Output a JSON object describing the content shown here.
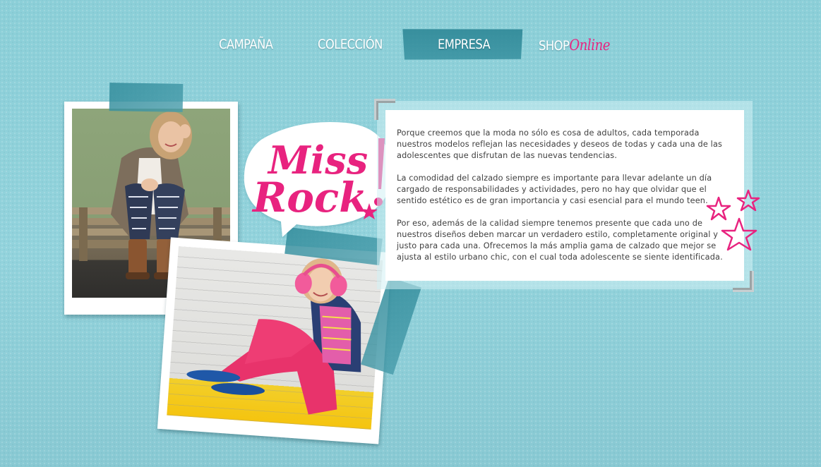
{
  "nav": {
    "items": [
      {
        "label": "CAMPAÑA"
      },
      {
        "label": "COLECCIÓN"
      },
      {
        "label": "EMPRESA",
        "active": true
      },
      {
        "label_main": "SHOP",
        "label_accent": "Online"
      }
    ]
  },
  "logo": {
    "line1": "Miss",
    "line2": "Rock"
  },
  "content": {
    "paragraphs": [
      "Porque creemos que la moda no sólo es cosa de adultos, cada temporada nuestros modelos reflejan las necesidades y deseos de todas y cada una de las adolescentes que disfrutan de las nuevas tendencias.",
      "La comodidad del calzado siempre es importante para llevar adelante un día cargado de responsabilidades y actividades, pero no hay que olvidar que el sentido estético es de gran importancia y casi esencial para el mundo teen.",
      "Por eso, además de la calidad siempre tenemos presente que cada uno de nuestros diseños deben marcar un verdadero estilo, completamente original y justo para cada una. Ofrecemos la más amplia gama de calzado que mejor se ajusta al estilo urbano chic, con el cual toda adolescente se siente identificada."
    ]
  },
  "colors": {
    "background": "#8fcfd8",
    "tape": "#3a8f9c",
    "accent_pink": "#e8237f",
    "text": "#3f3f3f"
  },
  "icons": [
    "star-doodle-icon",
    "corner-bracket-icon"
  ]
}
